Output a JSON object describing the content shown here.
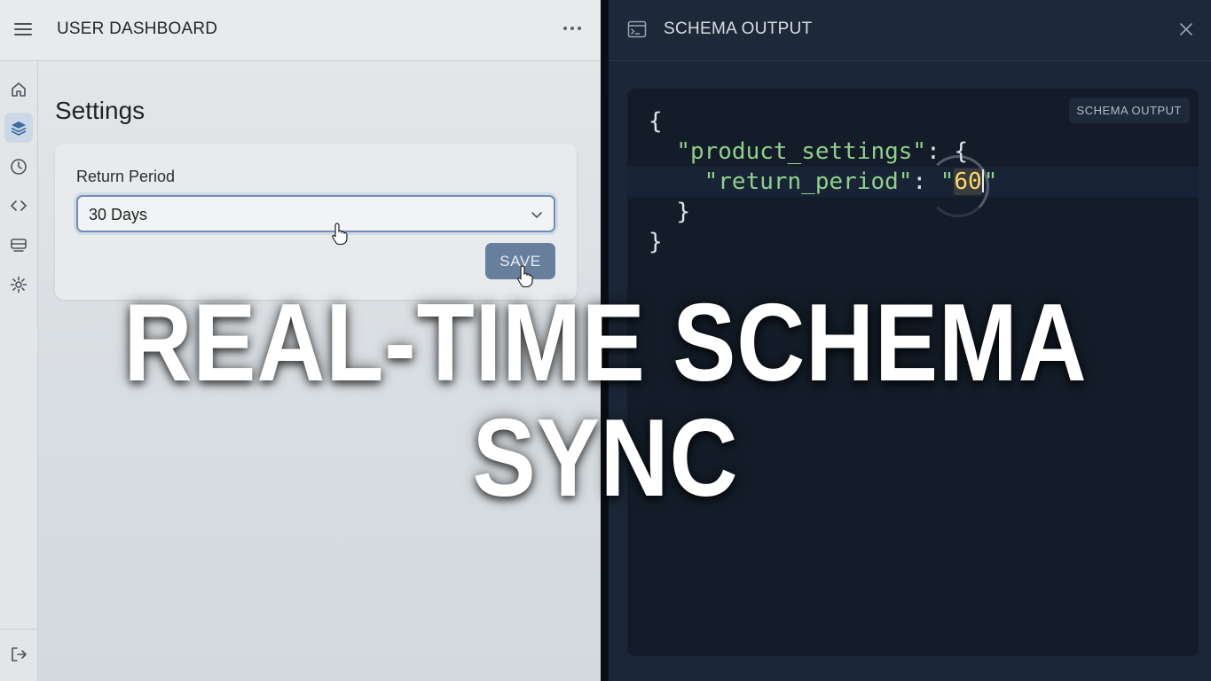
{
  "left": {
    "header": {
      "title": "USER DASHBOARD",
      "menu_icon": "hamburger-icon",
      "more_icon": "more-horizontal-icon"
    },
    "rail": {
      "items": [
        {
          "icon": "home-icon",
          "active": false
        },
        {
          "icon": "layers-icon",
          "active": true
        },
        {
          "icon": "clock-icon",
          "active": false
        },
        {
          "icon": "code-icon",
          "active": false
        },
        {
          "icon": "storage-icon",
          "active": false
        },
        {
          "icon": "gear-icon",
          "active": false
        }
      ],
      "bottom_icon": "logout-icon"
    },
    "page_title": "Settings",
    "form": {
      "label": "Return Period",
      "select_value": "30 Days",
      "save_label": "SAVE"
    }
  },
  "right": {
    "header": {
      "title": "SCHEMA OUTPUT",
      "icon": "terminal-icon",
      "close_icon": "close-icon"
    },
    "badge": "SCHEMA OUTPUT",
    "code": {
      "open_brace": "{",
      "key_outer": "\"product_settings\"",
      "colon_brace": ": {",
      "key_inner": "\"return_period\"",
      "colon": ": ",
      "quote_open": "\"",
      "value": "60",
      "quote_close": "\"",
      "inner_close": "}",
      "outer_close": "}"
    }
  },
  "overlay": {
    "headline": "REAL-TIME SCHEMA SYNC"
  },
  "colors": {
    "accent": "#677f9c",
    "code_string": "#8fd08a",
    "code_value": "#ffd86b",
    "panel_dark": "#1b2636"
  }
}
